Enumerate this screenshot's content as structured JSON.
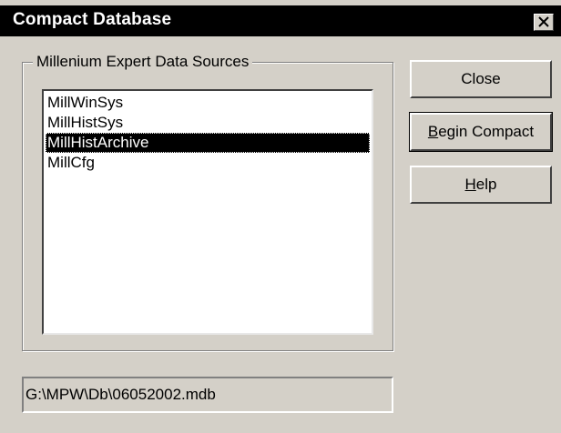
{
  "window": {
    "title": "Compact Database",
    "colors": {
      "face": "#d4d0c8",
      "titlebar": "#000000",
      "selection": "#000000"
    }
  },
  "title_bar": {
    "close_icon": "close-x-icon"
  },
  "group": {
    "legend": "Millenium Expert Data Sources",
    "items": [
      {
        "label": "MillWinSys",
        "selected": false
      },
      {
        "label": "MillHistSys",
        "selected": false
      },
      {
        "label": "MillHistArchive",
        "selected": true
      },
      {
        "label": "MillCfg",
        "selected": false
      }
    ]
  },
  "buttons": {
    "close": "Close",
    "begin_compact_prefix": "B",
    "begin_compact_rest": "egin Compact",
    "help_prefix": "H",
    "help_rest": "elp"
  },
  "status": {
    "path": "G:\\MPW\\Db\\06052002.mdb"
  }
}
